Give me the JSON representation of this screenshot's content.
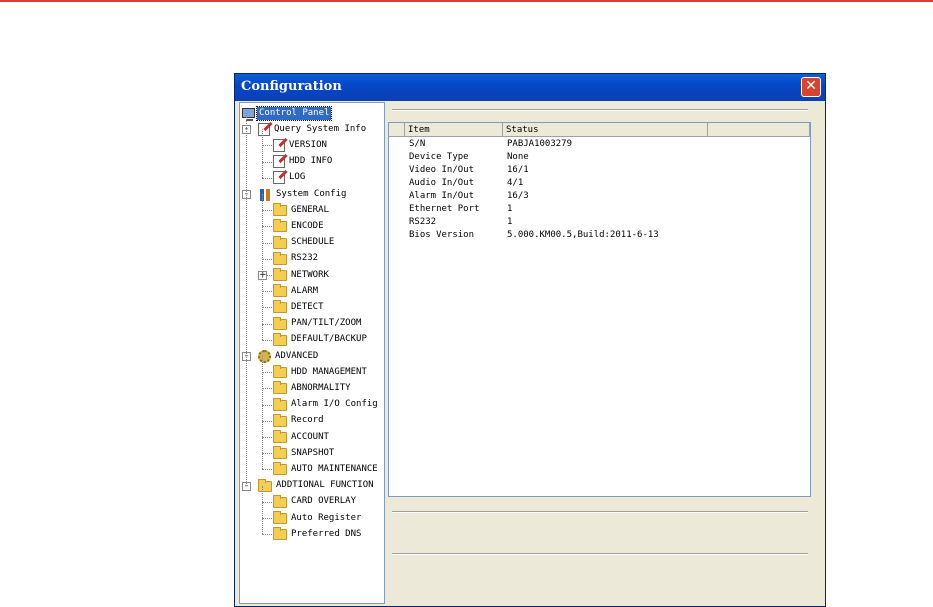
{
  "window": {
    "title": "Configuration"
  },
  "tree": {
    "root": "Control Panel",
    "groups": [
      {
        "label": "Query System Info",
        "icon": "edit-icon",
        "items": [
          "VERSION",
          "HDD INFO",
          "LOG"
        ]
      },
      {
        "label": "System Config",
        "icon": "tools-icon",
        "items": [
          "GENERAL",
          "ENCODE",
          "SCHEDULE",
          "RS232",
          "NETWORK",
          "ALARM",
          "DETECT",
          "PAN/TILT/ZOOM",
          "DEFAULT/BACKUP"
        ]
      },
      {
        "label": "ADVANCED",
        "icon": "gear-icon",
        "items": [
          "HDD MANAGEMENT",
          "ABNORMALITY",
          "Alarm I/O Config",
          "Record",
          "ACCOUNT",
          "SNAPSHOT",
          "AUTO MAINTENANCE"
        ]
      },
      {
        "label": "ADDTIONAL FUNCTION",
        "icon": "folder-icon",
        "items": [
          "CARD OVERLAY",
          "Auto Register",
          "Preferred DNS"
        ]
      }
    ]
  },
  "list": {
    "columns": [
      "Item",
      "Status"
    ],
    "rows": [
      [
        "S/N",
        "PABJA1003279"
      ],
      [
        "Device Type",
        "None"
      ],
      [
        "Video In/Out",
        "16/1"
      ],
      [
        "Audio In/Out",
        "4/1"
      ],
      [
        "Alarm In/Out",
        "16/3"
      ],
      [
        "Ethernet Port",
        "1"
      ],
      [
        "RS232",
        "1"
      ],
      [
        "Bios Version",
        "5.000.KM00.5,Build:2011-6-13"
      ]
    ]
  },
  "colors": {
    "accent_red": "#e03b3b",
    "titlebar_blue": "#0548c8",
    "selection": "#316ac5"
  }
}
